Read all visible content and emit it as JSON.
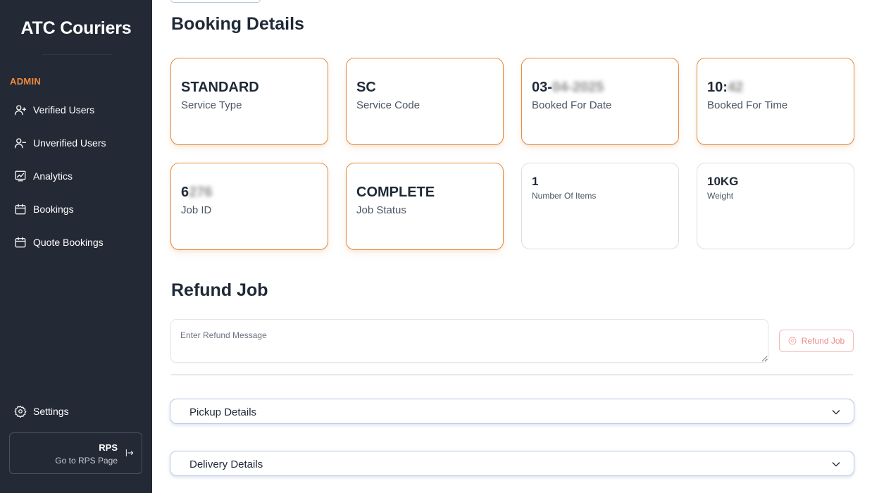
{
  "sidebar": {
    "brand": "ATC Couriers",
    "section_label": "ADMIN",
    "items": [
      {
        "label": "Verified Users",
        "icon": "user-check-icon"
      },
      {
        "label": "Unverified Users",
        "icon": "user-minus-icon"
      },
      {
        "label": "Analytics",
        "icon": "chart-icon"
      },
      {
        "label": "Bookings",
        "icon": "calendar-icon"
      },
      {
        "label": "Quote Bookings",
        "icon": "calendar-icon"
      }
    ],
    "settings_label": "Settings",
    "rps": {
      "title": "RPS",
      "subtitle": "Go to RPS Page"
    }
  },
  "booking": {
    "title": "Booking Details",
    "cards": [
      {
        "value": "STANDARD",
        "value_blurred": "",
        "label": "Service Type"
      },
      {
        "value": "SC",
        "value_blurred": "",
        "label": "Service Code"
      },
      {
        "value": "03-",
        "value_blurred": "04-2025",
        "label": "Booked For Date"
      },
      {
        "value": "10:",
        "value_blurred": "42",
        "label": "Booked For Time"
      },
      {
        "value": "6",
        "value_blurred": "276",
        "label": "Job ID"
      },
      {
        "value": "COMPLETE",
        "value_blurred": "",
        "label": "Job Status"
      },
      {
        "value": "1",
        "value_blurred": "",
        "label": "Number Of Items"
      },
      {
        "value": "10KG",
        "value_blurred": "",
        "label": "Weight"
      }
    ]
  },
  "refund": {
    "title": "Refund Job",
    "placeholder": "Enter Refund Message",
    "button_label": "Refund Job"
  },
  "sections": {
    "pickup_label": "Pickup Details",
    "delivery_label": "Delivery Details"
  },
  "colors": {
    "sidebar_bg": "#232a35",
    "accent_orange": "#e88a3a",
    "refund_red": "#ef8a8a",
    "accordion_border": "#b9c9e8"
  }
}
